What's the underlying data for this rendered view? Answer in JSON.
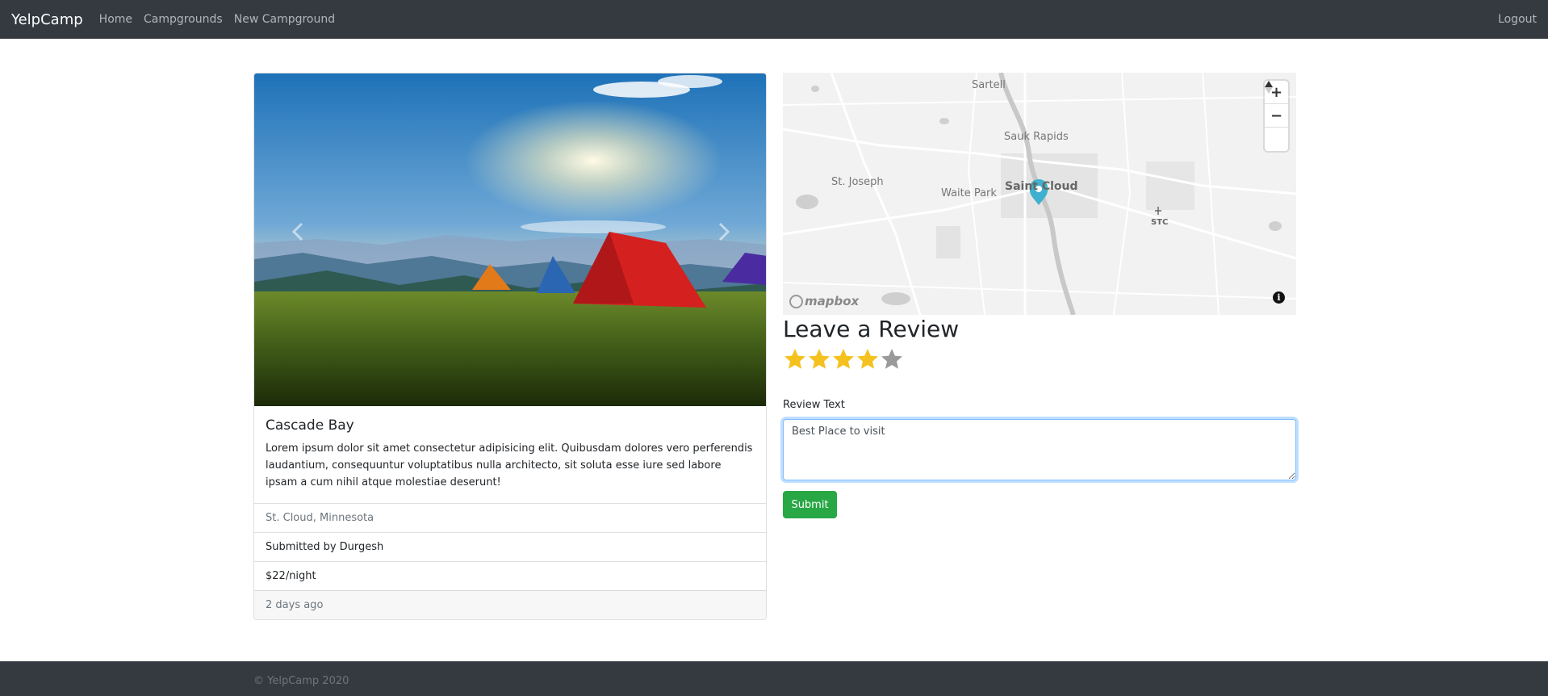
{
  "navbar": {
    "brand": "YelpCamp",
    "links": [
      "Home",
      "Campgrounds",
      "New Campground"
    ],
    "logout": "Logout"
  },
  "campground": {
    "title": "Cascade Bay",
    "description": "Lorem ipsum dolor sit amet consectetur adipisicing elit. Quibusdam dolores vero perferendis laudantium, consequuntur voluptatibus nulla architecto, sit soluta esse iure sed labore ipsam a cum nihil atque molestiae deserunt!",
    "location": "St. Cloud, Minnesota",
    "submitted_by": "Submitted by Durgesh",
    "price": "$22/night",
    "posted": "2 days ago"
  },
  "carousel": {
    "prev_icon": "chevron-left-icon",
    "next_icon": "chevron-right-icon"
  },
  "map": {
    "labels": {
      "sartell": "Sartell",
      "sauk_rapids": "Sauk Rapids",
      "st_joseph": "St. Joseph",
      "waite_park": "Waite Park",
      "saint_cloud": "Saint Cloud",
      "stc": "STC"
    },
    "attribution": "mapbox",
    "zoom_in": "+",
    "zoom_out": "−",
    "compass": "▲",
    "info": "i"
  },
  "review": {
    "title": "Leave a Review",
    "rating": 4,
    "max_rating": 5,
    "label": "Review Text",
    "value": "Best Place to visit",
    "submit": "Submit"
  },
  "footer": {
    "text": "© YelpCamp 2020"
  },
  "colors": {
    "navbar": "#343a40",
    "star_filled": "#f4c11f",
    "star_empty": "#9a9a9a",
    "submit": "#28a745",
    "pin": "#3fb1ce"
  }
}
